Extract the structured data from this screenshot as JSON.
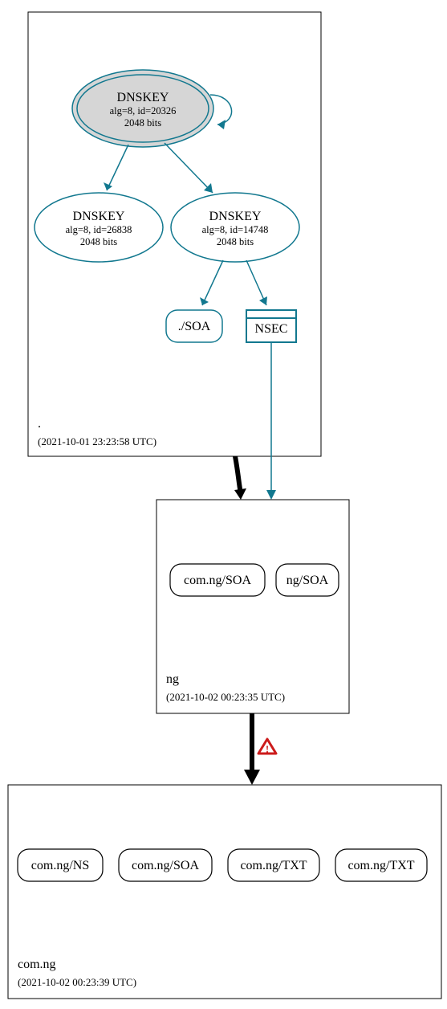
{
  "root": {
    "label": ".",
    "timestamp": "(2021-10-01 23:23:58 UTC)",
    "dnskey_ksk": {
      "title": "DNSKEY",
      "sub1": "alg=8, id=20326",
      "sub2": "2048 bits"
    },
    "dnskey_a": {
      "title": "DNSKEY",
      "sub1": "alg=8, id=26838",
      "sub2": "2048 bits"
    },
    "dnskey_b": {
      "title": "DNSKEY",
      "sub1": "alg=8, id=14748",
      "sub2": "2048 bits"
    },
    "soa": "./SOA",
    "nsec": "NSEC"
  },
  "ng": {
    "label": "ng",
    "timestamp": "(2021-10-02 00:23:35 UTC)",
    "rr_a": "com.ng/SOA",
    "rr_b": "ng/SOA"
  },
  "comng": {
    "label": "com.ng",
    "timestamp": "(2021-10-02 00:23:39 UTC)",
    "rr_a": "com.ng/NS",
    "rr_b": "com.ng/SOA",
    "rr_c": "com.ng/TXT",
    "rr_d": "com.ng/TXT"
  },
  "warning_glyph": "!"
}
